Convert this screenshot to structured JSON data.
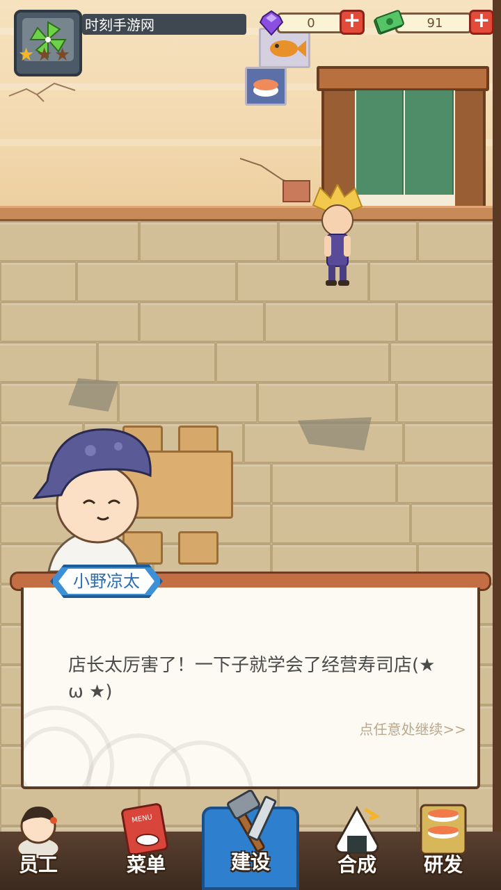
{
  "hud": {
    "player_name": "时刻手游网",
    "rating": {
      "filled": 1,
      "total": 3
    },
    "gems": "0",
    "cash": "91"
  },
  "dialogue": {
    "speaker": "小野凉太",
    "text": "店长太厉害了！一下子就学会了经营寿司店(★ ω ★)",
    "continue_hint": "点任意处继续>>"
  },
  "nav": {
    "items": [
      {
        "label": "员工",
        "icon": "staff-icon"
      },
      {
        "label": "菜单",
        "icon": "menu-book-icon"
      },
      {
        "label": "建设",
        "icon": "hammer-saw-icon",
        "active": true
      },
      {
        "label": "合成",
        "icon": "onigiri-icon"
      },
      {
        "label": "研发",
        "icon": "sushi-tray-icon"
      }
    ]
  },
  "colors": {
    "accent_blue": "#2f7fcf",
    "plus_red": "#e24a3a",
    "gem_purple": "#8a4fe0",
    "cash_green": "#3aa34a",
    "dialog_text": "#4b4b4b"
  }
}
